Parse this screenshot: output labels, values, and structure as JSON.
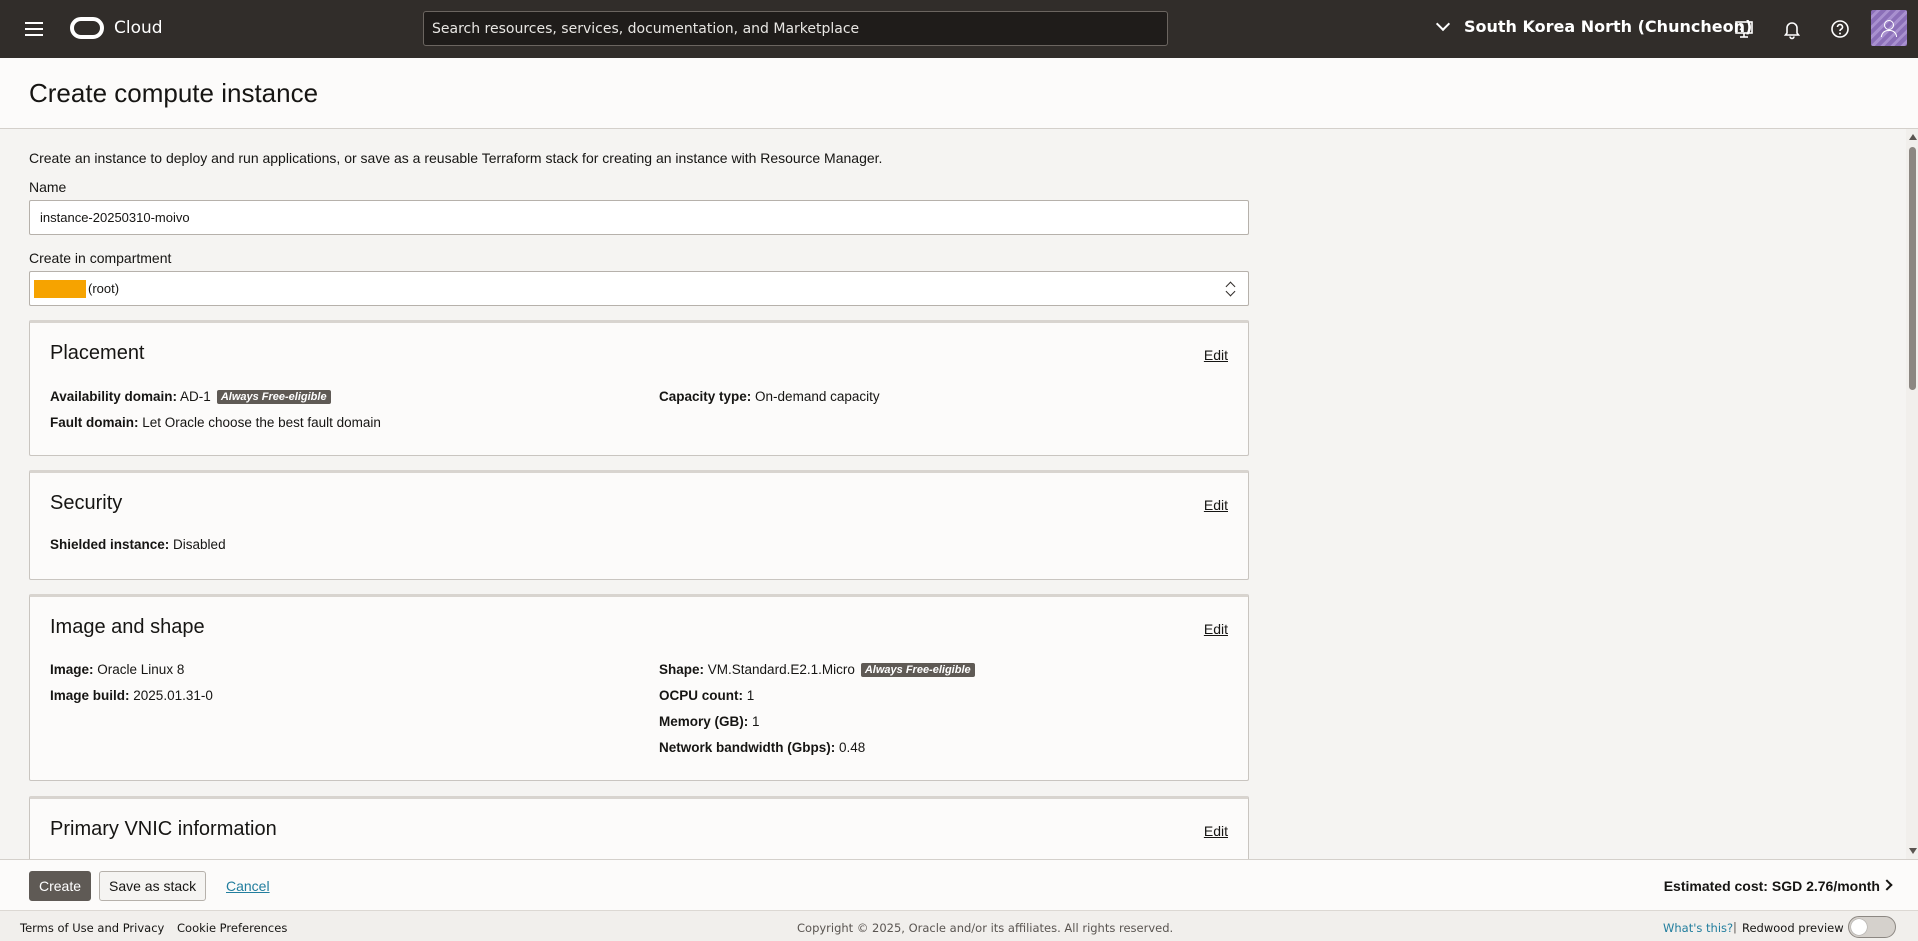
{
  "header": {
    "brand": "Cloud",
    "search_placeholder": "Search resources, services, documentation, and Marketplace",
    "region": "South Korea North (Chuncheon)"
  },
  "page": {
    "title": "Create compute instance",
    "intro": "Create an instance to deploy and run applications, or save as a reusable Terraform stack for creating an instance with Resource Manager."
  },
  "form": {
    "name_label": "Name",
    "name_value": "instance-20250310-moivo",
    "compartment_label": "Create in compartment",
    "compartment_value": "(root)"
  },
  "placement": {
    "title": "Placement",
    "edit": "Edit",
    "ad_label": "Availability domain:",
    "ad_value": "AD-1",
    "ad_badge": "Always Free-eligible",
    "capacity_label": "Capacity type:",
    "capacity_value": "On-demand capacity",
    "fault_label": "Fault domain:",
    "fault_value": "Let Oracle choose the best fault domain"
  },
  "security": {
    "title": "Security",
    "edit": "Edit",
    "shielded_label": "Shielded instance:",
    "shielded_value": "Disabled"
  },
  "image_shape": {
    "title": "Image and shape",
    "edit": "Edit",
    "image_label": "Image:",
    "image_value": "Oracle Linux 8",
    "build_label": "Image build:",
    "build_value": "2025.01.31-0",
    "shape_label": "Shape:",
    "shape_value": "VM.Standard.E2.1.Micro",
    "shape_badge": "Always Free-eligible",
    "ocpu_label": "OCPU count:",
    "ocpu_value": "1",
    "memory_label": "Memory (GB):",
    "memory_value": "1",
    "bandwidth_label": "Network bandwidth (Gbps):",
    "bandwidth_value": "0.48"
  },
  "vnic": {
    "title": "Primary VNIC information",
    "edit": "Edit"
  },
  "actions": {
    "create": "Create",
    "save_stack": "Save as stack",
    "cancel": "Cancel",
    "estimated_cost": "Estimated cost:  SGD 2.76/month"
  },
  "footer": {
    "terms": "Terms of Use and Privacy",
    "cookies": "Cookie Preferences",
    "copyright": "Copyright © 2025, Oracle and/or its affiliates. All rights reserved.",
    "whats_this": "What's this?",
    "separator": "|",
    "redwood": "Redwood preview"
  },
  "colors": {
    "header_bg": "#312d2a",
    "primary_button": "#5f5a55",
    "link": "#227e9e",
    "redaction": "#f6a300"
  },
  "icons": [
    "hamburger-icon",
    "oracle-logo",
    "chevron-down-icon",
    "cloud-shell-icon",
    "bell-icon",
    "help-icon",
    "user-avatar",
    "updown-icon",
    "chevron-right-icon"
  ]
}
